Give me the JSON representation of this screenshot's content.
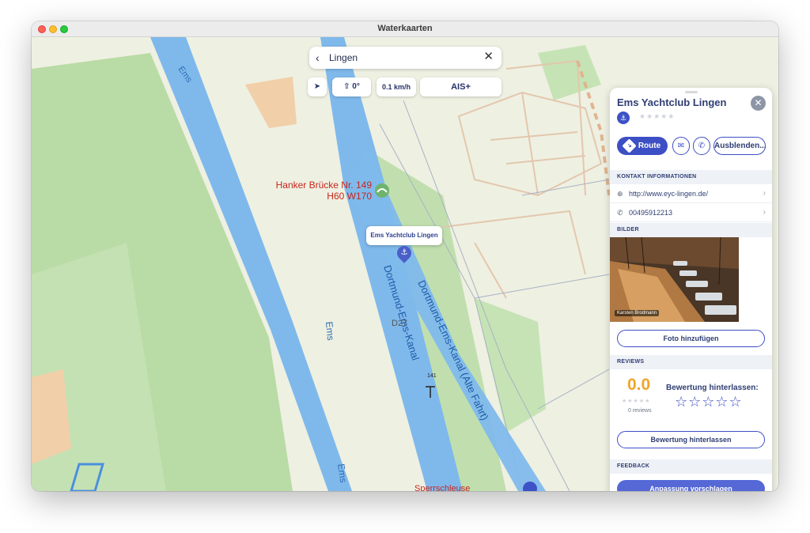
{
  "window": {
    "title": "Waterkaarten"
  },
  "search": {
    "query": "Lingen"
  },
  "controls": {
    "heading": "0°",
    "speed": "0.1 km/h",
    "ais": "AIS+"
  },
  "map_labels": {
    "river_ems": "Ems",
    "canal": "Dortmund-Ems-Kanal",
    "canal_old": "Dortmund-Ems-Kanal (Alte Fahrt)",
    "road": "D27",
    "km_marker": "141",
    "bridge_name": "Hanker Brücke Nr. 149",
    "bridge_dims": "H60 W170",
    "lock": "Sperrschleuse"
  },
  "tooltip": "Ems Yachtclub Lingen",
  "panel": {
    "title": "Ems Yachtclub Lingen",
    "route_label": "Route",
    "hide_label": "Ausblenden...",
    "contact_header": "KONTAKT INFORMATIONEN",
    "website": "http://www.eyc-lingen.de/",
    "phone": "00495912213",
    "images_header": "BILDER",
    "photo_credit": "Karsten Brodmann",
    "add_photo": "Foto hinzufügen",
    "reviews_header": "REVIEWS",
    "score": "0.0",
    "review_count": "0 reviews",
    "leave_rating": "Bewertung hinterlassen:",
    "leave_review": "Bewertung hinterlassen",
    "feedback_header": "FEEDBACK",
    "suggest": "Anpassung vorschlagen"
  },
  "colors": {
    "accent": "#3d4fc4",
    "water": "#7fb9ec",
    "score": "#f0a62b",
    "label_red": "#c8261c"
  },
  "icons": [
    "back-chevron-icon",
    "clear-icon",
    "location-arrow-icon",
    "compass-icon",
    "anchor-icon",
    "route-icon",
    "mail-icon",
    "phone-icon",
    "globe-icon",
    "close-icon",
    "star-icon"
  ]
}
